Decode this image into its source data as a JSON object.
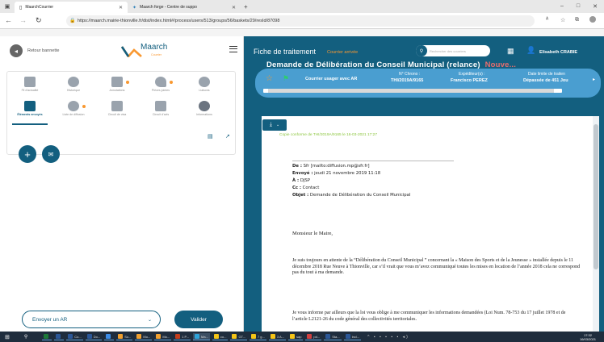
{
  "browser": {
    "tab1": "MaarchCourrier",
    "tab2": "Maarch forge - Centre de suppo",
    "new_tab": "+",
    "url": "https://maarch.mairie-thionville.fr/dist/index.html#/process/users/513/groups/56/baskets/29/resId/87098",
    "win_min": "–",
    "win_max": "□",
    "win_close": "✕"
  },
  "left": {
    "back_label": "Retour bannette",
    "logo_text": "Maarch",
    "logo_sub": "Courrier",
    "icons": [
      {
        "label": "Fil d'actualité",
        "name": "news-feed"
      },
      {
        "label": "Historique",
        "name": "history"
      },
      {
        "label": "Annotations",
        "name": "annotations"
      },
      {
        "label": "Pièces jointes",
        "name": "attachments"
      },
      {
        "label": "Liaisons",
        "name": "links"
      },
      {
        "label": "Éléments envoyés",
        "name": "sent-items"
      },
      {
        "label": "Liste de diffusion",
        "name": "diffusion-list"
      },
      {
        "label": "Circuit de visa",
        "name": "visa-circuit"
      },
      {
        "label": "Circuit d'avis",
        "name": "opinion-circuit"
      },
      {
        "label": "Informations",
        "name": "informations"
      }
    ],
    "action_select": "Envoyer un AR",
    "validate": "Valider"
  },
  "right": {
    "title": "Fiche de traitement",
    "subtitle": "Courrier arrivée",
    "search_placeholder": "Rechercher des courriers",
    "user": "Elisabeth CRABIE",
    "heading": "Demande de Délibération du Conseil Municipal (relance)",
    "heading_badge": "Nouve...",
    "category": "Courrier usager avec AR",
    "chrono_label": "N° Chrono :",
    "chrono_value": "THI/2019A/9165",
    "sender_label": "Expéditeur(s) :",
    "sender_value": "Francisco PEREZ",
    "deadline_label": "Date limite de traiten",
    "deadline_value": "Dépassée de 451 Jou"
  },
  "doc": {
    "copy_note": "Copie conforme de THI/2019A/9165 le 16-03-2021 17:27",
    "mail": [
      {
        "k": "De :",
        "v": " Sfr [mailto:diffusion.mp@sfr.fr]"
      },
      {
        "k": "Envoyé :",
        "v": " jeudi 21 novembre 2019 11:18"
      },
      {
        "k": "À :",
        "v": " DJSP"
      },
      {
        "k": "Cc :",
        "v": " Contact"
      },
      {
        "k": "Objet :",
        "v": " Demande de Délibération du Conseil Municipal"
      }
    ],
    "salutation": "Monsieur le Maire,",
    "p1": "Je suis toujours en attente de la “Délibération du Conseil Municipal ” concernant la « Maison des Sports et de la Jeunesse » installée depuis le 11 décembre 2018 Rue Neuve à Thionville, car s’il vrait que vous m’avez communiqué toutes les mises en location de l’année 2018 cela ne correspond pas du tout à ma demande.",
    "p2": "Je vous informe par ailleurs que la loi vous oblige à me communiquer les informations demandées (Loi Num. 78-753 du 17 juillet 1978 et de l’article L2121-26 du code général des collectivités territoriales."
  },
  "taskbar": {
    "items": [
      "Co...",
      "Do...",
      "So...",
      "Mo...",
      "Mo...",
      "1 P...",
      "Ma...",
      "co...",
      "GT...",
      "7 g...",
      "3 A...",
      "sap",
      "pd...",
      "Sta...",
      "Incl..."
    ],
    "time": "17:32",
    "date": "16/03/2021"
  },
  "colors": {
    "brand_dark": "#135f7f",
    "brand_light": "#4a9ed0",
    "accent": "#f99830",
    "badge_red": "#e96d6d"
  }
}
